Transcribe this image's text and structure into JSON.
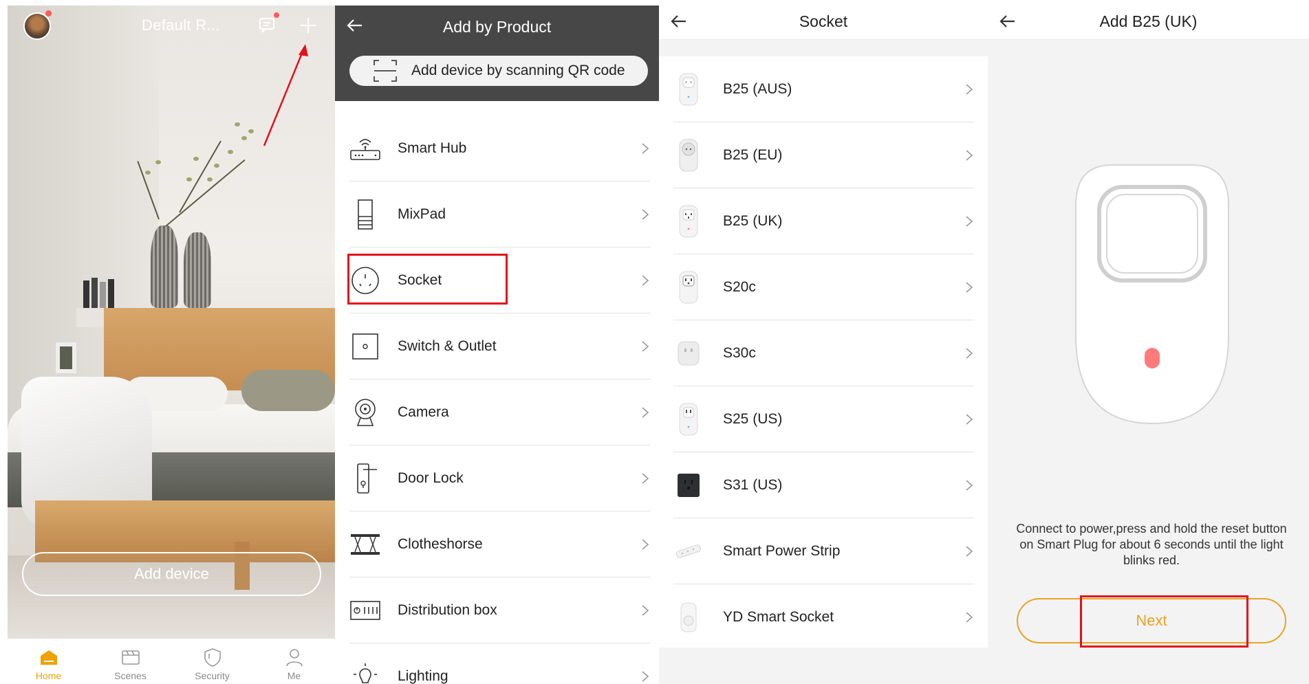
{
  "home": {
    "title": "Default R...",
    "add_device_label": "Add device",
    "tabs": [
      {
        "label": "Home",
        "icon": "home-icon",
        "active": true
      },
      {
        "label": "Scenes",
        "icon": "scenes-icon"
      },
      {
        "label": "Security",
        "icon": "security-shield-icon"
      },
      {
        "label": "Me",
        "icon": "person-icon"
      }
    ]
  },
  "add_by_product": {
    "title": "Add by Product",
    "qr_label": "Add device by scanning QR code",
    "categories": [
      {
        "label": "Smart Hub",
        "icon": "router-icon"
      },
      {
        "label": "MixPad",
        "icon": "panel-icon"
      },
      {
        "label": "Socket",
        "icon": "socket-icon",
        "highlighted": true
      },
      {
        "label": "Switch & Outlet",
        "icon": "switch-icon"
      },
      {
        "label": "Camera",
        "icon": "camera-icon"
      },
      {
        "label": "Door Lock",
        "icon": "door-lock-icon"
      },
      {
        "label": "Clotheshorse",
        "icon": "clotheshorse-icon"
      },
      {
        "label": "Distribution box",
        "icon": "distribution-box-icon"
      },
      {
        "label": "Lighting",
        "icon": "bulb-icon"
      }
    ]
  },
  "socket": {
    "title": "Socket",
    "products": [
      {
        "label": "B25 (AUS)"
      },
      {
        "label": "B25 (EU)"
      },
      {
        "label": "B25 (UK)"
      },
      {
        "label": "S20c"
      },
      {
        "label": "S30c"
      },
      {
        "label": "S25 (US)"
      },
      {
        "label": "S31 (US)"
      },
      {
        "label": "Smart Power Strip"
      },
      {
        "label": "YD Smart Socket"
      }
    ]
  },
  "add_b25": {
    "title": "Add B25 (UK)",
    "instruction": "Connect to power,press and hold  the reset button on Smart Plug for about 6 seconds until the light blinks red.",
    "next_label": "Next"
  },
  "colors": {
    "accent": "#f0a000",
    "highlight": "#e4101b",
    "header_dark": "#474747"
  }
}
